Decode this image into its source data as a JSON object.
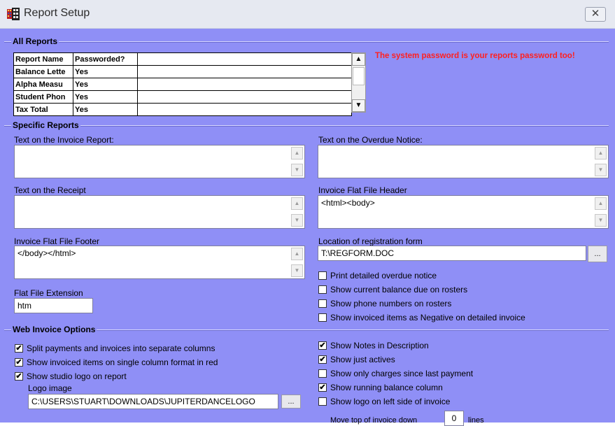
{
  "window": {
    "title": "Report Setup",
    "close_label": "✕"
  },
  "all_reports": {
    "section_title": "All Reports",
    "columns": [
      "Report Name",
      "Passworded?"
    ],
    "rows": [
      {
        "name": "Balance Lette",
        "passworded": "Yes"
      },
      {
        "name": "Alpha Measu",
        "passworded": "Yes"
      },
      {
        "name": "Student Phon",
        "passworded": "Yes"
      },
      {
        "name": "Tax Total",
        "passworded": "Yes"
      }
    ],
    "warning": "The system password is your reports password too!"
  },
  "specific_reports": {
    "section_title": "Specific Reports",
    "invoice_text_label": "Text on the Invoice Report:",
    "invoice_text_value": "",
    "overdue_text_label": "Text on the Overdue Notice:",
    "overdue_text_value": "",
    "receipt_text_label": "Text on the Receipt",
    "receipt_text_value": "",
    "flat_header_label": "Invoice Flat File Header",
    "flat_header_value": "<html><body>",
    "flat_footer_label": "Invoice Flat File Footer",
    "flat_footer_value": "</body></html>",
    "reg_form_label": "Location of registration form",
    "reg_form_value": "T:\\REGFORM.DOC",
    "browse_label": "...",
    "extension_label": "Flat File Extension",
    "extension_value": "htm",
    "options": [
      {
        "label": "Print detailed overdue notice",
        "checked": false
      },
      {
        "label": "Show current balance due on rosters",
        "checked": false
      },
      {
        "label": "Show phone numbers on rosters",
        "checked": false
      },
      {
        "label": "Show invoiced items as Negative on detailed invoice",
        "checked": false
      }
    ]
  },
  "web_invoice": {
    "section_title": "Web Invoice Options",
    "left_options": [
      {
        "label": "Split payments and invoices into separate columns",
        "checked": true
      },
      {
        "label": "Show invoiced items on single column format in red",
        "checked": true
      },
      {
        "label": "Show studio logo on report",
        "checked": true
      }
    ],
    "logo_label": "Logo image",
    "logo_value": "C:\\USERS\\STUART\\DOWNLOADS\\JUPITERDANCELOGO",
    "logo_browse_label": "...",
    "right_options": [
      {
        "label": "Show Notes in Description",
        "checked": true
      },
      {
        "label": "Show just actives",
        "checked": true
      },
      {
        "label": "Show only charges since last payment",
        "checked": false
      },
      {
        "label": "Show running balance column",
        "checked": true
      },
      {
        "label": "Show logo on left side of invoice",
        "checked": false
      }
    ],
    "move_top_label": "Move top of invoice down",
    "move_top_value": "0",
    "move_top_unit": "lines"
  },
  "check_glyph": "✔"
}
